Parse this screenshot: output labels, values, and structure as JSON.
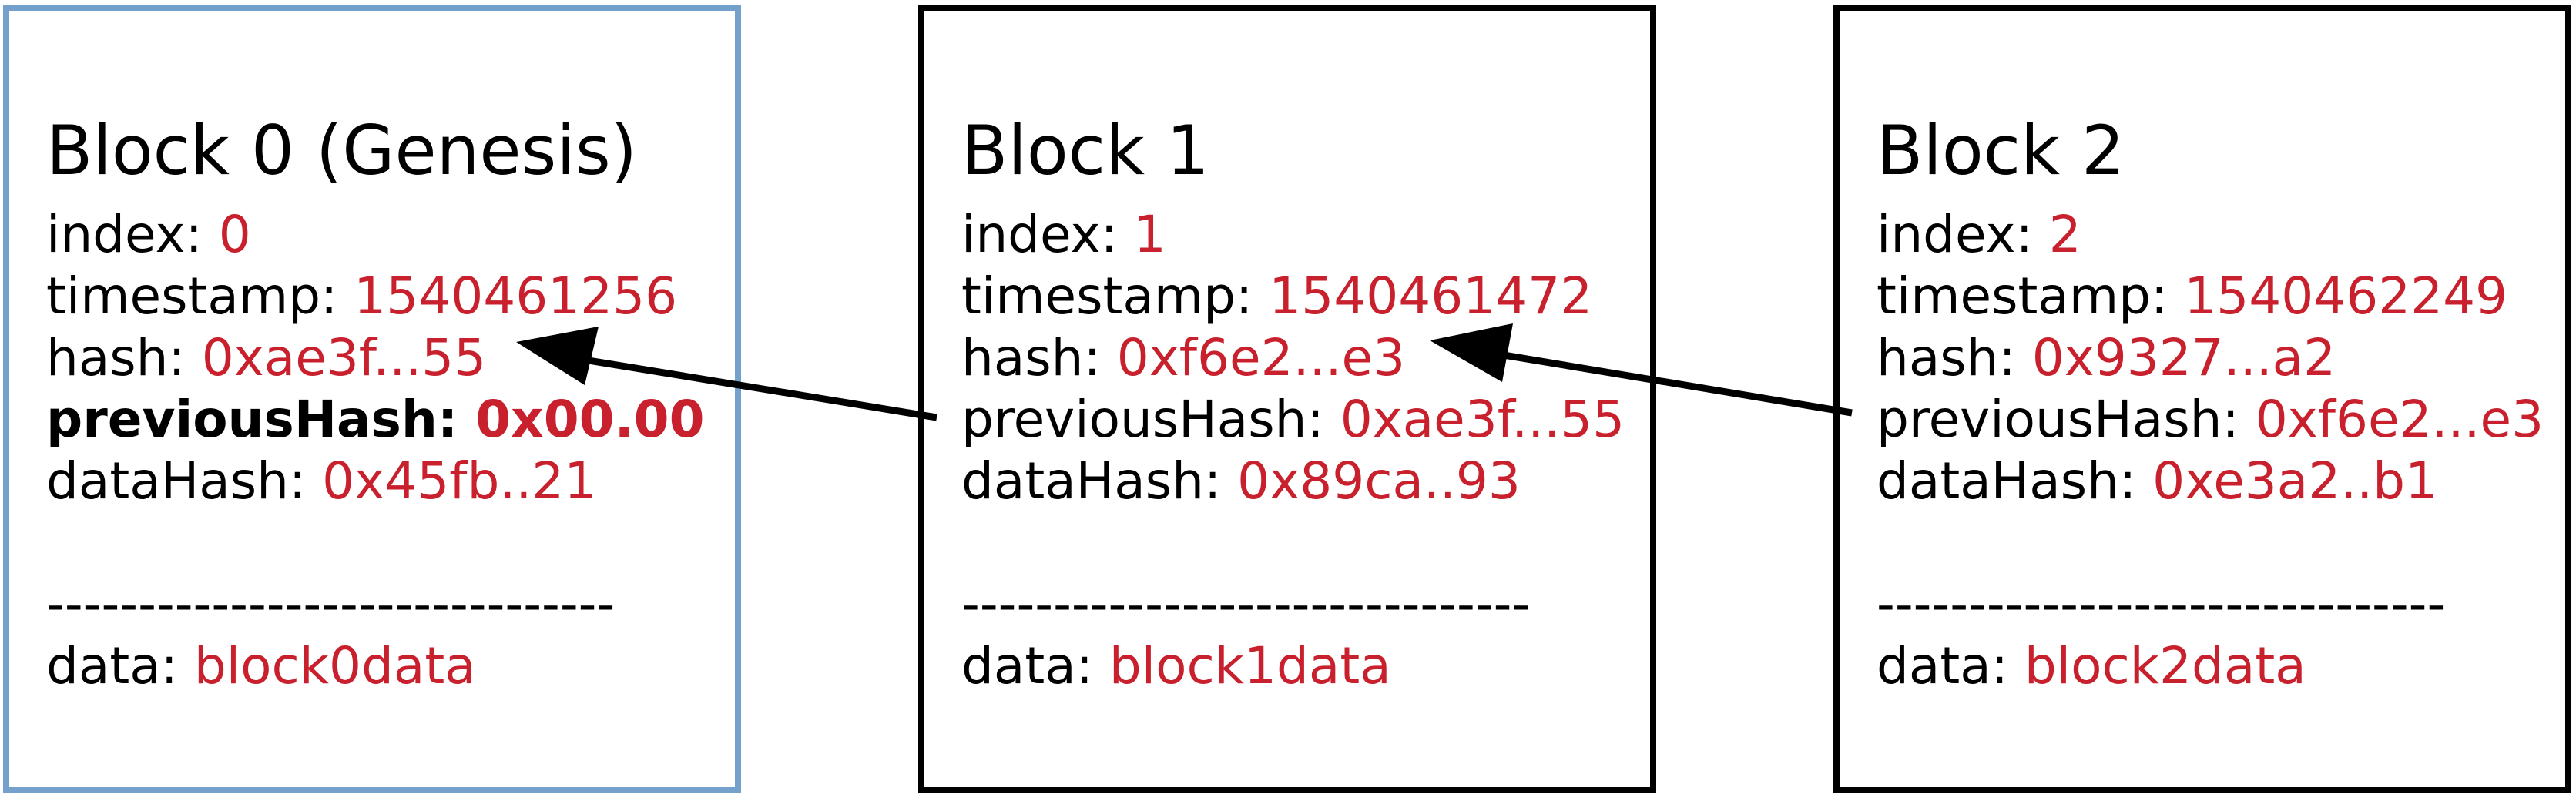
{
  "labels": {
    "index": "index: ",
    "timestamp": "timestamp: ",
    "hash": "hash: ",
    "previous_hash": "previousHash: ",
    "data_hash": "dataHash: ",
    "separator": "-------------------------------",
    "data": "data: "
  },
  "blocks": [
    {
      "title": "Block 0 (Genesis)",
      "index": "0",
      "timestamp": "1540461256",
      "hash": "0xae3f...55",
      "previous_hash": "0x00.00",
      "data_hash": "0x45fb..21",
      "data": "block0data"
    },
    {
      "title": "Block 1",
      "index": "1",
      "timestamp": "1540461472",
      "hash": "0xf6e2...e3",
      "previous_hash": "0xae3f...55",
      "data_hash": "0x89ca..93",
      "data": "block1data"
    },
    {
      "title": "Block 2",
      "index": "2",
      "timestamp": "1540462249",
      "hash": "0x9327...a2",
      "previous_hash": "0xf6e2...e3",
      "data_hash": "0xe3a2..b1",
      "data": "block2data"
    }
  ],
  "colors": {
    "value": "#c8202c",
    "genesis_border": "#74a0cc",
    "block_border": "#000000",
    "arrow": "#000000"
  }
}
